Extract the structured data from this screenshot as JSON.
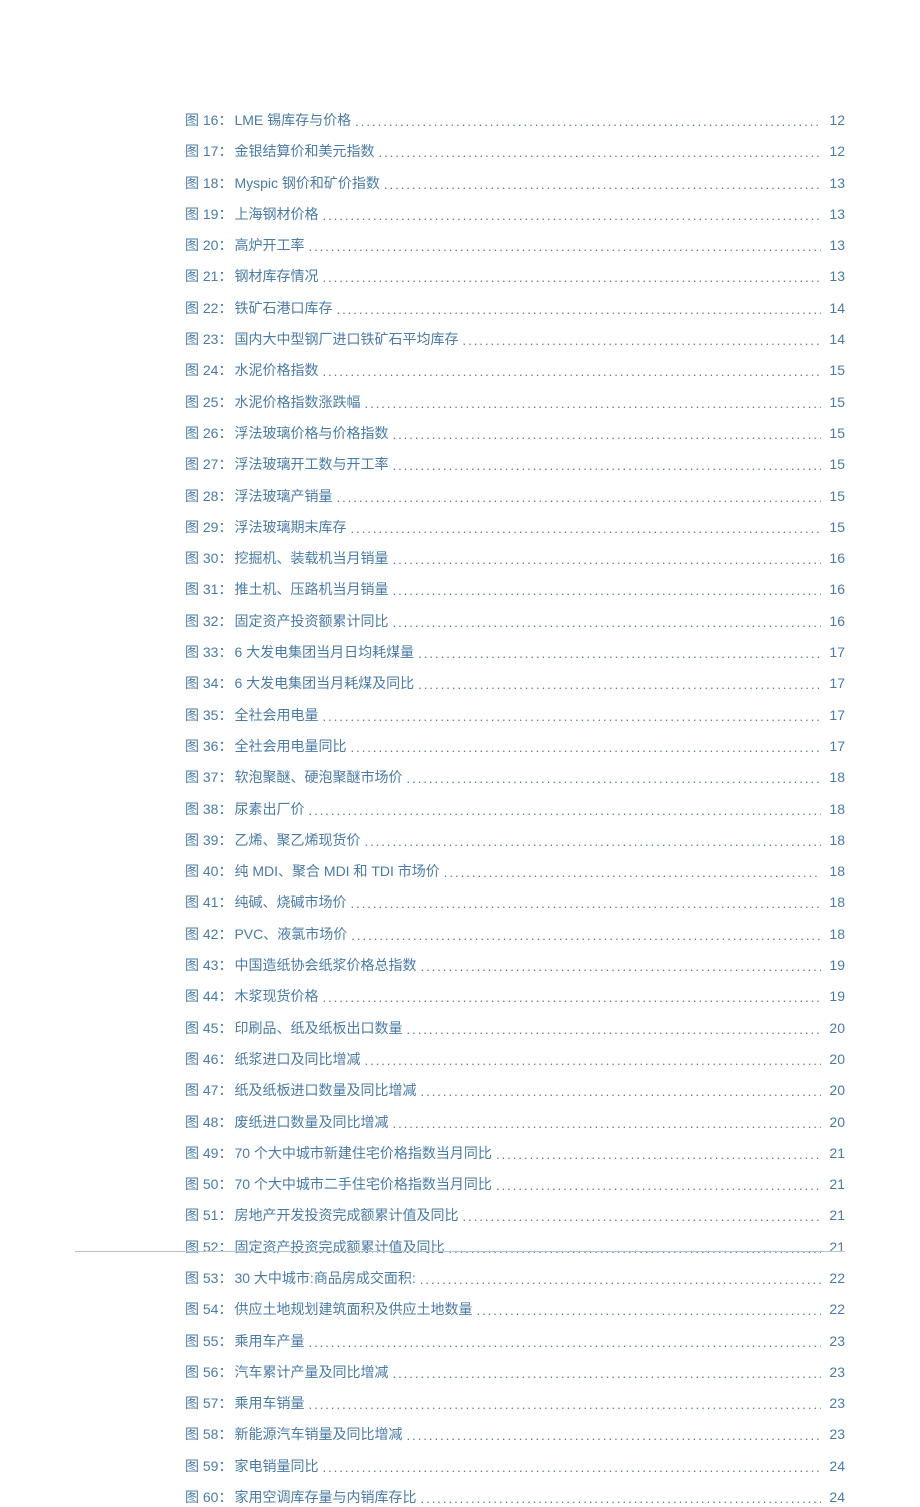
{
  "toc": {
    "entries": [
      {
        "label": "图 16：",
        "title": "LME 锡库存与价格",
        "page": "12"
      },
      {
        "label": "图 17：",
        "title": "金银结算价和美元指数",
        "page": "12"
      },
      {
        "label": "图 18：",
        "title": "Myspic 钢价和矿价指数",
        "page": "13"
      },
      {
        "label": "图 19：",
        "title": "上海钢材价格",
        "page": "13"
      },
      {
        "label": "图 20：",
        "title": "高炉开工率",
        "page": "13"
      },
      {
        "label": "图 21：",
        "title": "钢材库存情况",
        "page": "13"
      },
      {
        "label": "图 22：",
        "title": "铁矿石港口库存",
        "page": "14"
      },
      {
        "label": "图 23：",
        "title": "国内大中型钢厂进口铁矿石平均库存",
        "page": "14"
      },
      {
        "label": "图 24：",
        "title": "水泥价格指数",
        "page": "15"
      },
      {
        "label": "图 25：",
        "title": "水泥价格指数涨跌幅",
        "page": "15"
      },
      {
        "label": "图 26：",
        "title": "浮法玻璃价格与价格指数",
        "page": "15"
      },
      {
        "label": "图 27：",
        "title": "浮法玻璃开工数与开工率",
        "page": "15"
      },
      {
        "label": "图 28：",
        "title": "浮法玻璃产销量",
        "page": "15"
      },
      {
        "label": "图 29：",
        "title": "浮法玻璃期末库存",
        "page": "15"
      },
      {
        "label": "图 30：",
        "title": "挖掘机、装载机当月销量",
        "page": "16"
      },
      {
        "label": "图 31：",
        "title": "推土机、压路机当月销量",
        "page": "16"
      },
      {
        "label": "图 32：",
        "title": "固定资产投资额累计同比",
        "page": "16"
      },
      {
        "label": "图 33：",
        "title": "6 大发电集团当月日均耗煤量",
        "page": "17"
      },
      {
        "label": "图 34：",
        "title": "6 大发电集团当月耗煤及同比",
        "page": "17"
      },
      {
        "label": "图 35：",
        "title": "全社会用电量",
        "page": "17"
      },
      {
        "label": "图 36：",
        "title": "全社会用电量同比",
        "page": "17"
      },
      {
        "label": "图 37：",
        "title": "软泡聚醚、硬泡聚醚市场价",
        "page": "18"
      },
      {
        "label": "图 38：",
        "title": "尿素出厂价",
        "page": "18"
      },
      {
        "label": "图 39：",
        "title": "乙烯、聚乙烯现货价",
        "page": "18"
      },
      {
        "label": "图 40：",
        "title": "纯 MDI、聚合 MDI 和 TDI 市场价",
        "page": "18"
      },
      {
        "label": "图 41：",
        "title": "纯碱、烧碱市场价",
        "page": "18"
      },
      {
        "label": "图 42：",
        "title": "PVC、液氯市场价",
        "page": "18"
      },
      {
        "label": "图 43：",
        "title": "中国造纸协会纸浆价格总指数",
        "page": "19"
      },
      {
        "label": "图 44：",
        "title": "木浆现货价格",
        "page": "19"
      },
      {
        "label": "图 45：",
        "title": "印刷品、纸及纸板出口数量",
        "page": "20"
      },
      {
        "label": "图 46：",
        "title": "纸浆进口及同比增减",
        "page": "20"
      },
      {
        "label": "图 47：",
        "title": "纸及纸板进口数量及同比增减",
        "page": "20"
      },
      {
        "label": "图 48：",
        "title": "废纸进口数量及同比增减",
        "page": "20"
      },
      {
        "label": "图 49：",
        "title": "70 个大中城市新建住宅价格指数当月同比",
        "page": "21"
      },
      {
        "label": "图 50：",
        "title": "70 个大中城市二手住宅价格指数当月同比",
        "page": "21"
      },
      {
        "label": "图 51：",
        "title": "房地产开发投资完成额累计值及同比",
        "page": "21"
      },
      {
        "label": "图 52：",
        "title": "固定资产投资完成额累计值及同比",
        "page": "21"
      },
      {
        "label": "图 53：",
        "title": "30 大中城市:商品房成交面积:",
        "page": "22"
      },
      {
        "label": "图 54：",
        "title": "供应土地规划建筑面积及供应土地数量",
        "page": "22"
      },
      {
        "label": "图 55：",
        "title": "乘用车产量",
        "page": "23"
      },
      {
        "label": "图 56：",
        "title": "汽车累计产量及同比增减",
        "page": "23"
      },
      {
        "label": "图 57：",
        "title": "乘用车销量",
        "page": "23"
      },
      {
        "label": "图 58：",
        "title": "新能源汽车销量及同比增减",
        "page": "23"
      },
      {
        "label": "图 59：",
        "title": "家电销量同比",
        "page": "24"
      },
      {
        "label": "图 60：",
        "title": "家用空调库存量与内销库存比",
        "page": "24"
      }
    ]
  }
}
